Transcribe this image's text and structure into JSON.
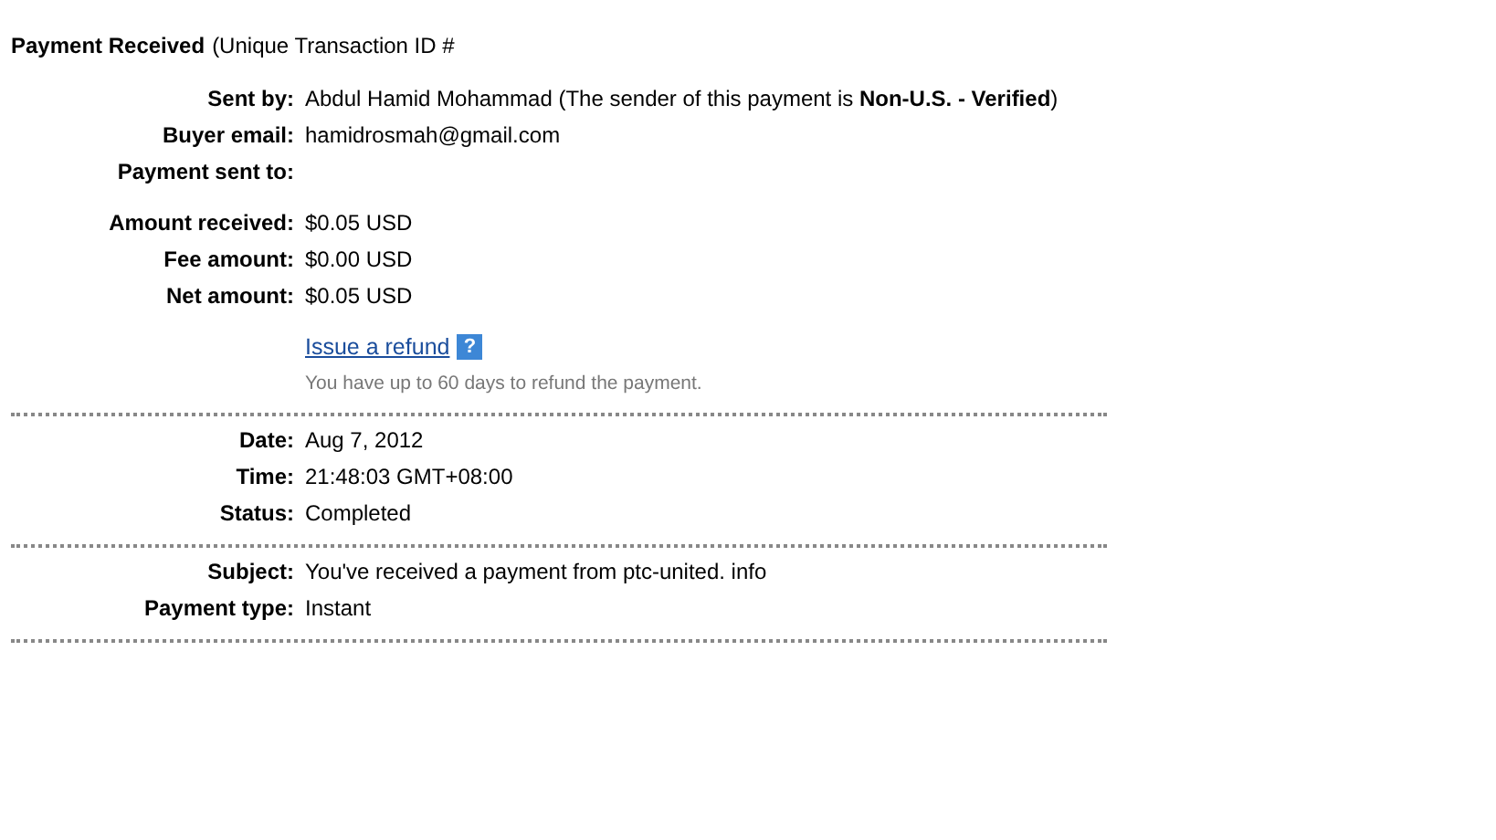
{
  "header": {
    "title": "Payment Received",
    "subtitle": "(Unique Transaction ID #"
  },
  "sections": [
    {
      "groups": [
        {
          "rows": [
            {
              "label": "Sent by:",
              "value": "Abdul Hamid Mohammad (The sender of this payment is **Non-U.S. - Verified**)"
            },
            {
              "label": "Buyer email:",
              "value": "hamidrosmah@gmail.com"
            },
            {
              "label": "Payment sent to:",
              "value": ""
            }
          ]
        },
        {
          "rows": [
            {
              "label": "Amount received:",
              "value": "$0.05 USD"
            },
            {
              "label": "Fee amount:",
              "value": "$0.00 USD"
            },
            {
              "label": "Net amount:",
              "value": "$0.05 USD"
            }
          ],
          "refund": {
            "link": "Issue a refund",
            "help": "?",
            "note": "You have up to 60 days to refund the payment."
          }
        }
      ]
    },
    {
      "groups": [
        {
          "rows": [
            {
              "label": "Date:",
              "value": "Aug 7, 2012"
            },
            {
              "label": "Time:",
              "value": "21:48:03 GMT+08:00"
            },
            {
              "label": "Status:",
              "value": "Completed"
            }
          ]
        }
      ]
    },
    {
      "groups": [
        {
          "rows": [
            {
              "label": "Subject:",
              "value": "You've received a payment from ptc-united. info"
            },
            {
              "label": "Payment type:",
              "value": "Instant"
            }
          ]
        }
      ]
    }
  ]
}
